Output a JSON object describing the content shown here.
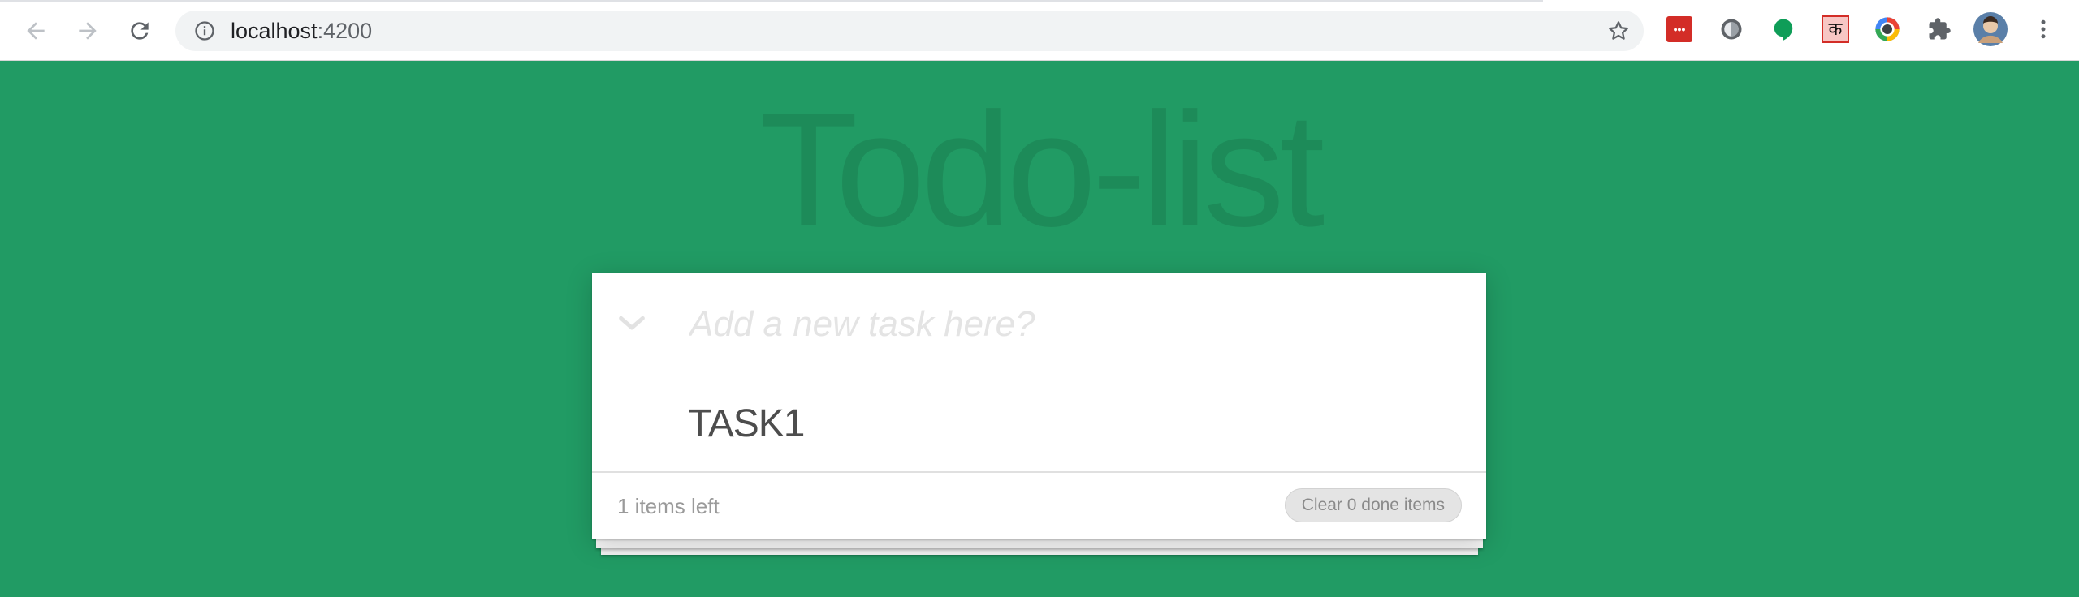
{
  "browser": {
    "url_host": "localhost",
    "url_port": ":4200",
    "icons": {
      "back": "back-arrow-icon",
      "forward": "forward-arrow-icon",
      "reload": "reload-icon",
      "info": "info-icon",
      "bookmark": "bookmark-star-icon"
    },
    "extensions": [
      {
        "name": "lastpass-extension-icon",
        "color": "#d32d27",
        "glyph": "•••"
      },
      {
        "name": "circle-extension-icon",
        "color": "#5f6368",
        "glyph": ""
      },
      {
        "name": "hangouts-extension-icon",
        "color": "#0f9d58",
        "glyph": ""
      },
      {
        "name": "hindi-ka-extension-icon",
        "color": "#d32d27",
        "glyph": "क"
      },
      {
        "name": "color-picker-extension-icon",
        "color": "#4285f4",
        "glyph": ""
      },
      {
        "name": "puzzle-extensions-icon",
        "color": "#5f6368",
        "glyph": ""
      }
    ],
    "avatar": "profile-avatar",
    "menu": "kebab-menu-icon"
  },
  "app": {
    "title": "Todo-list",
    "new_task_placeholder": "Add a new task here?",
    "toggle_all_icon": "chevron-down-icon",
    "tasks": [
      {
        "label": "TASK1",
        "done": false
      }
    ],
    "footer": {
      "items_left": "1 items left",
      "clear_button": "Clear 0 done items"
    },
    "colors": {
      "background": "#219b64",
      "card": "#ffffff"
    }
  }
}
